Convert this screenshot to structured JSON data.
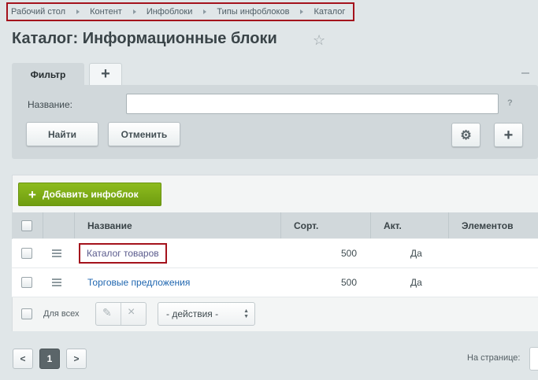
{
  "breadcrumb": [
    "Рабочий стол",
    "Контент",
    "Инфоблоки",
    "Типы инфоблоков",
    "Каталог"
  ],
  "page_title": "Каталог: Информационные блоки",
  "filter": {
    "tab_label": "Фильтр",
    "add_tab_label": "+",
    "name_label": "Название:",
    "name_value": "",
    "help": "?",
    "find_label": "Найти",
    "cancel_label": "Отменить"
  },
  "grid": {
    "add_button_label": "Добавить инфоблок",
    "columns": [
      "Название",
      "Сорт.",
      "Акт.",
      "Элементов"
    ],
    "rows": [
      {
        "name": "Каталог товаров",
        "sort": "500",
        "active": "Да"
      },
      {
        "name": "Торговые предложения",
        "sort": "500",
        "active": "Да"
      }
    ],
    "for_all_label": "Для всех",
    "actions_select": "- действия -"
  },
  "pagination": {
    "prev": "<",
    "current": "1",
    "next": ">",
    "per_page_label": "На странице:"
  },
  "colors": {
    "accent_green": "#7aa816",
    "highlight_red": "#a4121c",
    "link": "#2067b0"
  }
}
